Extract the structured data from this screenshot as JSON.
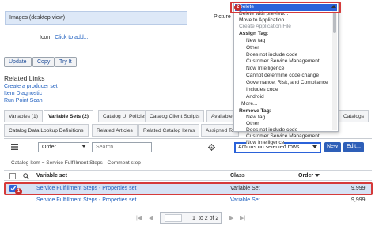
{
  "form": {
    "images_field": "Images (desktop view)",
    "icon_label": "Icon",
    "icon_link": "Click to add...",
    "picture_label": "Picture"
  },
  "buttons": {
    "update": "Update",
    "copy": "Copy",
    "try_it": "Try It"
  },
  "related_links": {
    "title": "Related Links",
    "items": [
      "Create a producer set",
      "Item Diagnostic",
      "Run Point Scan"
    ]
  },
  "tabs": {
    "row1": [
      "Variables (1)",
      "Variable Sets (2)",
      "Catalog UI Policies",
      "Catalog Client Scripts",
      "Available F",
      "Catalogs"
    ],
    "row2": [
      "Catalog Data Lookup Definitions",
      "Related Articles",
      "Related Catalog Items",
      "Assigned To"
    ]
  },
  "list_toolbar": {
    "order_select": "Order",
    "search_placeholder": "Search",
    "actions_select": "Actions on selected rows...",
    "new_button": "New",
    "edit_button": "Edit..."
  },
  "breadcrumb": "Catalog Item = Service Fulfillment Steps - Comment step",
  "table": {
    "columns": [
      "Variable set",
      "Class",
      "Order"
    ],
    "rows": [
      {
        "variable_set": "Service Fulfillment Steps - Properties set",
        "class": "Variable Set",
        "order": "9,999",
        "selected": true
      },
      {
        "variable_set": "Service Fulfillment Steps - Properties set",
        "class": "Variable Set",
        "order": "9,999",
        "selected": false
      }
    ]
  },
  "pagination": {
    "current": "1",
    "text": "to 2 of 2"
  },
  "context_menu": {
    "items": [
      {
        "label": "Delete",
        "kind": "selected"
      },
      {
        "label": "Delete with preview...",
        "kind": "item"
      },
      {
        "label": "Move to Application...",
        "kind": "item"
      },
      {
        "label": "Create Application File",
        "kind": "disabled"
      },
      {
        "label": "Assign Tag:",
        "kind": "group"
      },
      {
        "label": "New tag",
        "kind": "sub"
      },
      {
        "label": "Other",
        "kind": "sub"
      },
      {
        "label": "Does not include code",
        "kind": "sub"
      },
      {
        "label": "Customer Service Management",
        "kind": "sub"
      },
      {
        "label": "Now Intelligence",
        "kind": "sub"
      },
      {
        "label": "Cannot determine code change",
        "kind": "sub"
      },
      {
        "label": "Governance, Risk, and Compliance",
        "kind": "sub"
      },
      {
        "label": "Includes code",
        "kind": "sub"
      },
      {
        "label": "Android",
        "kind": "sub"
      },
      {
        "label": "More...",
        "kind": "sub"
      },
      {
        "label": "Remove Tag:",
        "kind": "group"
      },
      {
        "label": "New tag",
        "kind": "sub"
      },
      {
        "label": "Other",
        "kind": "sub"
      },
      {
        "label": "Does not include code",
        "kind": "sub"
      },
      {
        "label": "Customer Service Management",
        "kind": "sub"
      },
      {
        "label": "Now Intelligence",
        "kind": "sub"
      }
    ]
  },
  "annotations": {
    "badge1": "1",
    "badge2": "2"
  },
  "icons": {
    "menu": "hamburger-icon",
    "search": "search-icon",
    "settings": "gear-icon",
    "chevron": "chevron-down-icon"
  },
  "colors": {
    "accent": "#2b62d9",
    "highlight": "#d53a3a",
    "selected_row": "#d6e2f4",
    "primary_button": "#2e5fb8"
  }
}
